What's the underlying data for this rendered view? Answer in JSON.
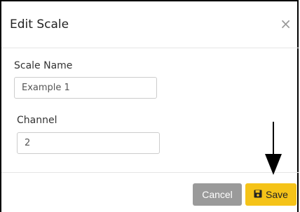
{
  "dialog": {
    "title": "Edit Scale",
    "close_glyph": "×"
  },
  "form": {
    "scale_name_label": "Scale Name",
    "scale_name_value": "Example 1",
    "channel_label": "Channel",
    "channel_value": "2"
  },
  "footer": {
    "cancel_label": "Cancel",
    "save_label": "Save",
    "save_icon": "floppy-disk-icon"
  },
  "colors": {
    "save_bg": "#f5c318",
    "cancel_bg": "#9a9a9a"
  }
}
